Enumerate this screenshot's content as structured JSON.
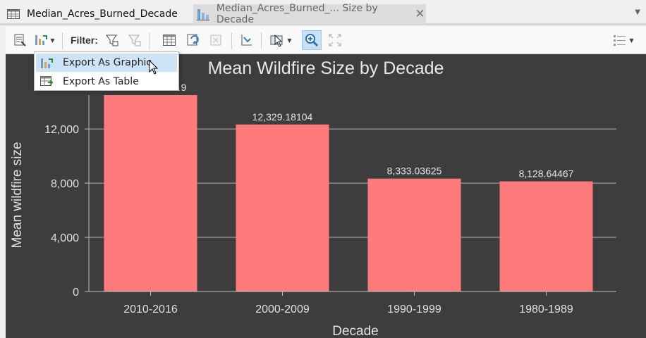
{
  "tabs": [
    {
      "label": "Median_Acres_Burned_Decade",
      "icon": "table-icon",
      "active": true
    },
    {
      "label": "Median_Acres_Burned_... Size by Decade",
      "icon": "bar-chart-icon",
      "active": false
    }
  ],
  "toolbar": {
    "filter_label": "Filter:",
    "icons": [
      "properties-icon",
      "export-chart-icon",
      "filter-by-selection-icon",
      "filter-clear-icon",
      "table-view-icon",
      "switch-selection-icon",
      "clear-selection-icon",
      "sort-icon",
      "select-icon",
      "zoom-icon",
      "full-extent-icon",
      "list-icon"
    ]
  },
  "menu": {
    "items": [
      {
        "label": "Export As Graphic",
        "icon": "export-graphic-icon"
      },
      {
        "label": "Export As Table",
        "icon": "export-table-icon"
      }
    ]
  },
  "chart_data": {
    "type": "bar",
    "title": "Mean Wildfire Size by Decade",
    "xlabel": "Decade",
    "ylabel": "Mean wildfire size",
    "categories": [
      "2010-2016",
      "2000-2009",
      "1990-1999",
      "1980-1989"
    ],
    "values": [
      14500,
      12329.18104,
      8333.03625,
      8128.64467
    ],
    "data_labels": [
      "…9",
      "12,329.18104",
      "8,333.03625",
      "8,128.64467"
    ],
    "yticks": [
      0,
      4000,
      8000,
      12000
    ],
    "ytick_labels": [
      "0",
      "4,000",
      "8,000",
      "12,000"
    ],
    "ylim": [
      0,
      14500
    ],
    "grid": true,
    "bar_color": "#ff7a7a",
    "background": "#3d3d3d"
  }
}
